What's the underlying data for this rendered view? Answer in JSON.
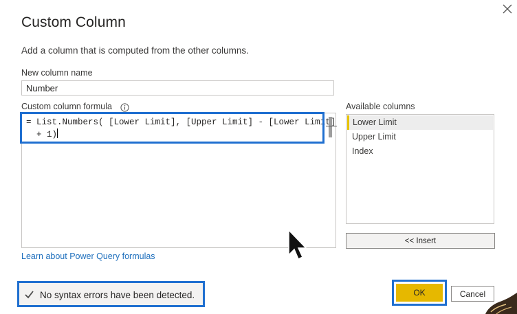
{
  "dialog": {
    "title": "Custom Column",
    "description": "Add a column that is computed from the other columns."
  },
  "new_column": {
    "label": "New column name",
    "value": "Number"
  },
  "formula": {
    "label": "Custom column formula",
    "line1": "= List.Numbers( [Lower Limit], [Upper Limit] - [Lower Limit]",
    "line2": "  + 1)"
  },
  "available_columns": {
    "label": "Available columns",
    "items": [
      "Lower Limit",
      "Upper Limit",
      "Index"
    ],
    "selected_index": 0
  },
  "insert_label": "<< Insert",
  "learn_link": "Learn about Power Query formulas",
  "status": {
    "message": "No syntax errors have been detected."
  },
  "buttons": {
    "ok": "OK",
    "cancel": "Cancel"
  },
  "colors": {
    "highlight_outline": "#1f6fd0",
    "ok_button": "#e6b800",
    "link": "#1e6fbd",
    "selected_accent": "#e6c200"
  },
  "icons": {
    "close": "close-icon",
    "info": "info-icon",
    "check": "check-icon",
    "cursor": "mouse-cursor-icon"
  }
}
